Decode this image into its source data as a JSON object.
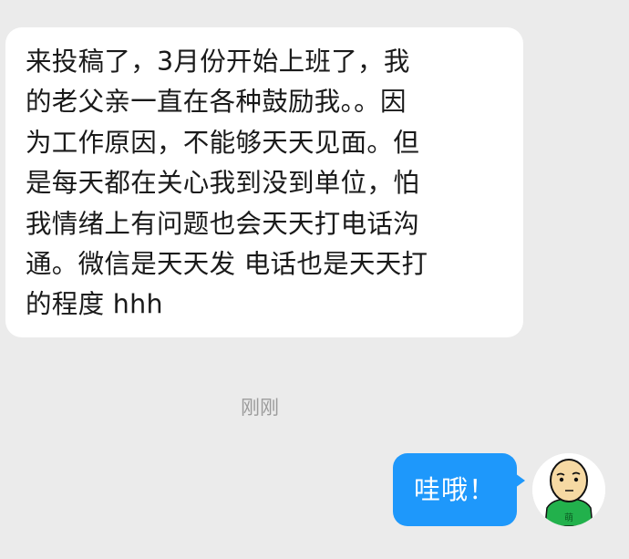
{
  "chat": {
    "incoming_message": {
      "text": "来投稿了，3月份开始上班了，我\n的老父亲一直在各种鼓励我。。因\n为工作原因，不能够天天见面。但\n是每天都在关心我到没到单位，怕\n我情绪上有问题也会天天打电话沟\n通。微信是天天发 电话也是天天打\n的程度 hhh"
    },
    "timestamp": "刚刚",
    "outgoing_message": {
      "text": "哇哦！"
    },
    "avatar": {
      "icon": "cartoon-bean-face-avatar",
      "shirt_color": "#22b14c",
      "shirt_text": "萌"
    }
  },
  "colors": {
    "background": "#ebebeb",
    "incoming_bubble": "#ffffff",
    "outgoing_bubble": "#1e98fb",
    "timestamp_text": "#9b9b9b"
  }
}
